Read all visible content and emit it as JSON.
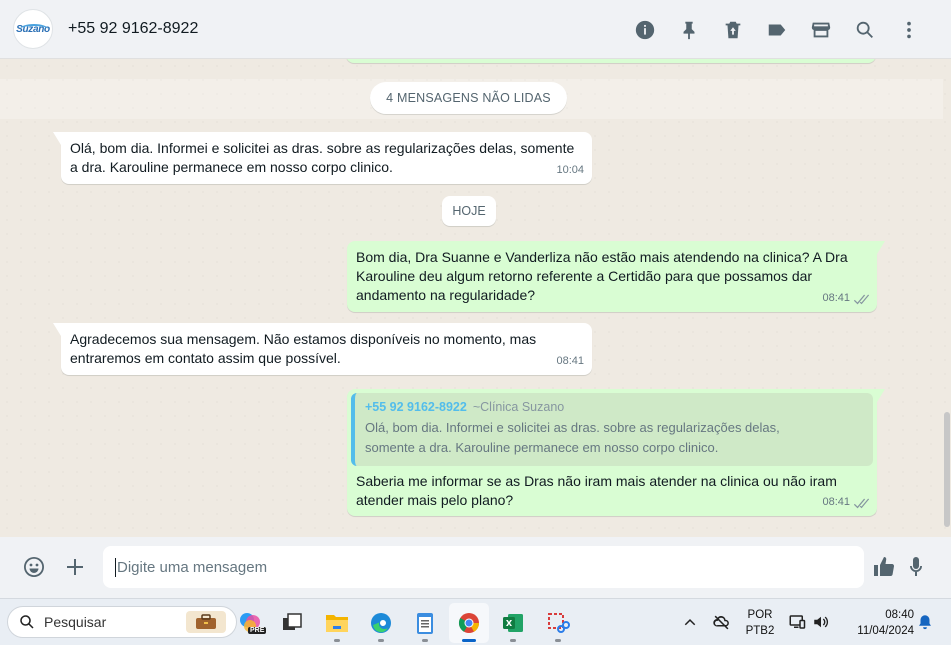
{
  "header": {
    "avatar_logo": "Suzano",
    "contact_name": "+55 92 9162-8922",
    "icons": [
      "info-icon",
      "pin-icon",
      "delete-icon",
      "label-icon",
      "catalog-icon",
      "search-icon",
      "menu-icon"
    ]
  },
  "chat": {
    "unread_banner": "4 MENSAGENS NÃO LIDAS",
    "date_separator": "HOJE",
    "messages": [
      {
        "direction": "in",
        "text": "Olá, bom dia. Informei e solicitei as dras. sobre as regularizações delas, somente a dra. Karouline permanece em nosso corpo clinico.",
        "time": "10:04"
      },
      {
        "direction": "out",
        "text": "Bom dia, Dra Suanne e Vanderliza não estão mais atendendo na clinica? A Dra Karouline deu algum retorno referente a Certidão para que possamos dar andamento na regularidade?",
        "time": "08:41",
        "status": "read"
      },
      {
        "direction": "in",
        "text": "Agradecemos sua mensagem. Não estamos disponíveis no momento, mas entraremos em contato assim que possível.",
        "time": "08:41"
      },
      {
        "direction": "out",
        "quote": {
          "number": "+55 92 9162-8922",
          "pushname": "~Clínica Suzano",
          "text": "Olá, bom dia. Informei e solicitei as dras. sobre as regularizações delas, somente a dra. Karouline permanece em nosso corpo clinico."
        },
        "text": "Saberia me informar se as Dras não iram mais atender na clinica ou não iram atender mais pelo plano?",
        "time": "08:41",
        "status": "read"
      }
    ]
  },
  "composer": {
    "placeholder": "Digite uma mensagem"
  },
  "taskbar": {
    "search_placeholder": "Pesquisar",
    "copilot_badge": "PRE",
    "language": "POR",
    "keyboard": "PTB2",
    "time": "08:40",
    "date": "11/04/2024"
  },
  "colors": {
    "outgoing_bubble": "#d9fdd3",
    "incoming_bubble": "#ffffff",
    "quote_accent": "#53bdeb",
    "chat_background": "#efeae2"
  }
}
